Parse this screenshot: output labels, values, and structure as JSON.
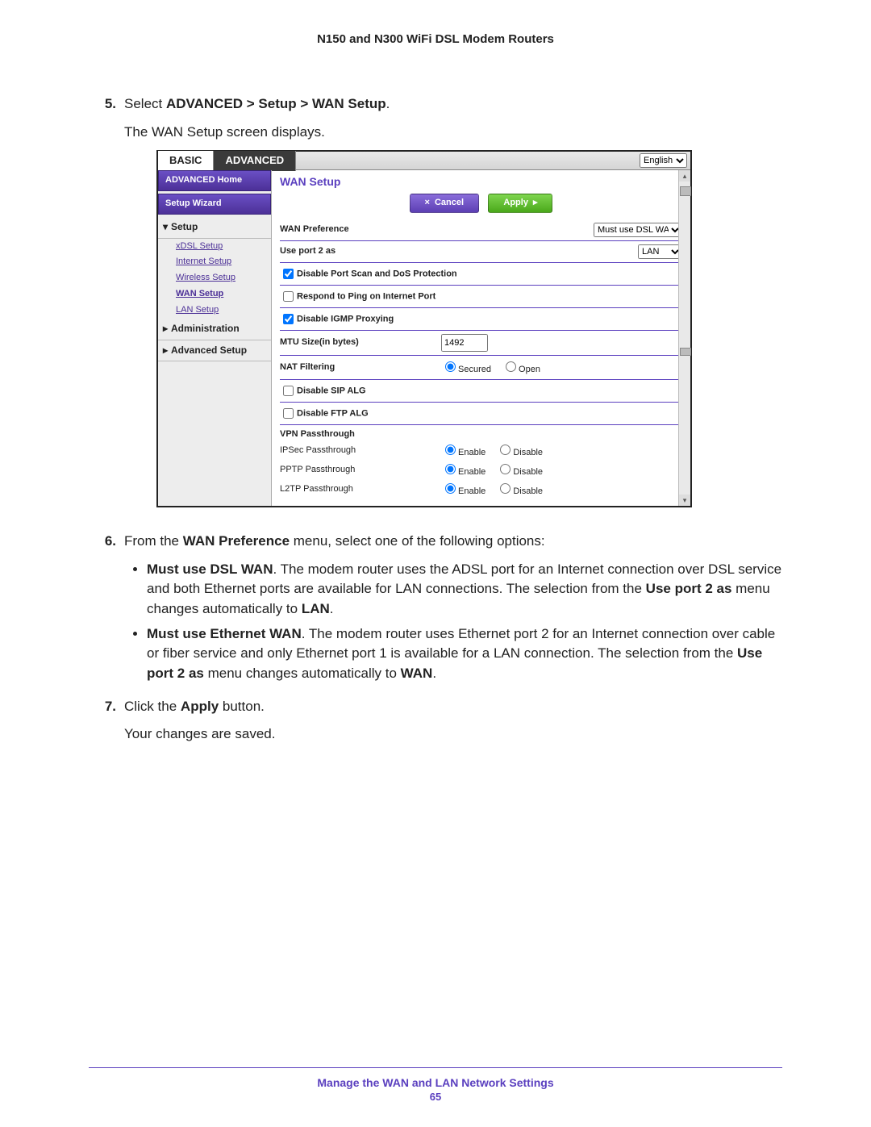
{
  "doc_title": "N150 and N300 WiFi DSL Modem Routers",
  "steps": {
    "s5": {
      "num": "5.",
      "line1_prefix": "Select ",
      "line1_bold": "ADVANCED > Setup > WAN Setup",
      "line1_suffix": ".",
      "line2": "The WAN Setup screen displays."
    },
    "s6": {
      "num": "6.",
      "intro_prefix": "From the ",
      "intro_bold1": "WAN Preference",
      "intro_suffix": " menu, select one of the following options:",
      "b1_bold": "Must use DSL WAN",
      "b1_mid": ". The modem router uses the ADSL port for an Internet connection over DSL service and both Ethernet ports are available for LAN connections. The selection from the ",
      "b1_bold2": "Use port 2 as",
      "b1_tail": " menu changes automatically to ",
      "b1_last": "LAN",
      "b1_period": ".",
      "b2_bold": "Must use Ethernet WAN",
      "b2_mid": ". The modem router uses Ethernet port 2 for an Internet connection over cable or fiber service and only Ethernet port 1 is available for a LAN connection. The selection from the ",
      "b2_bold2": "Use port 2 as",
      "b2_tail": " menu changes automatically to ",
      "b2_last": "WAN",
      "b2_period": "."
    },
    "s7": {
      "num": "7.",
      "line1_prefix": "Click the ",
      "line1_bold": "Apply",
      "line1_suffix": " button.",
      "line2": "Your changes are saved."
    }
  },
  "ss": {
    "tabs": {
      "basic": "BASIC",
      "advanced": "ADVANCED"
    },
    "lang": {
      "selected": "English"
    },
    "sidebar": {
      "home": "ADVANCED Home",
      "wizard": "Setup Wizard",
      "setup": "Setup",
      "subs": [
        "xDSL Setup",
        "Internet Setup",
        "Wireless Setup",
        "WAN Setup",
        "LAN Setup"
      ],
      "admin": "Administration",
      "advsetup": "Advanced Setup"
    },
    "panel": {
      "title": "WAN Setup",
      "btn_cancel": "Cancel",
      "btn_apply": "Apply",
      "rows": {
        "wan_pref": "WAN Preference",
        "wan_pref_val": "Must use DSL WAN",
        "port2": "Use port 2 as",
        "port2_val": "LAN",
        "disable_dos": "Disable Port Scan and DoS Protection",
        "respond_ping": "Respond to Ping on Internet Port",
        "disable_igmp": "Disable IGMP Proxying",
        "mtu": "MTU Size(in bytes)",
        "mtu_val": "1492",
        "nat": "NAT Filtering",
        "nat_secured": "Secured",
        "nat_open": "Open",
        "dis_sip": "Disable SIP ALG",
        "dis_ftp": "Disable FTP ALG",
        "vpn_head": "VPN Passthrough",
        "ipsec": "IPSec Passthrough",
        "pptp": "PPTP Passthrough",
        "l2tp": "L2TP Passthrough",
        "enable": "Enable",
        "disable": "Disable"
      }
    }
  },
  "footer": {
    "section": "Manage the WAN and LAN Network Settings",
    "page": "65"
  }
}
